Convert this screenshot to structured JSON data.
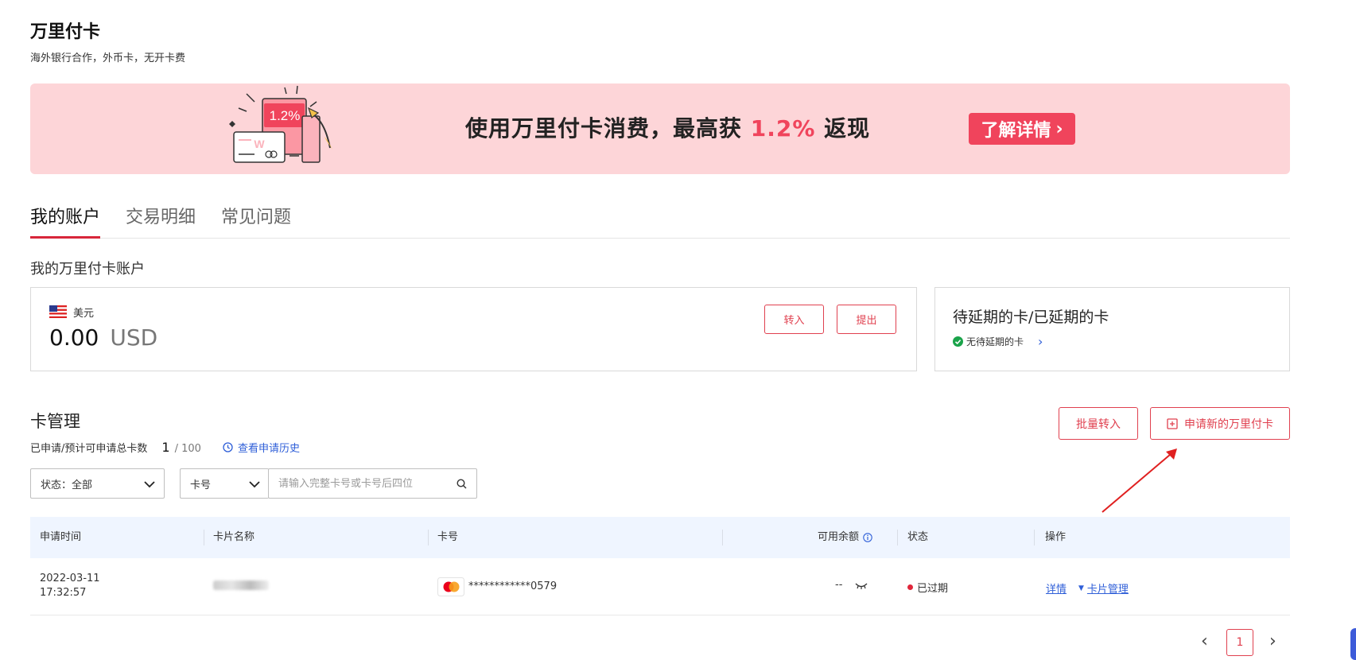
{
  "header": {
    "title": "万里付卡",
    "subtitle": "海外银行合作，外币卡，无开卡费"
  },
  "banner": {
    "text_pre": "使用万里付卡消费，最高获",
    "text_highlight": "1.2%",
    "text_post": "返现",
    "card_badge": "1.2%",
    "card_letter": "W",
    "button_label": "了解详情",
    "button_chevron": "›"
  },
  "tabs": [
    {
      "label": "我的账户",
      "active": true
    },
    {
      "label": "交易明细",
      "active": false
    },
    {
      "label": "常见问题",
      "active": false
    }
  ],
  "account": {
    "section_label": "我的万里付卡账户",
    "currency_name": "美元",
    "balance_value": "0.00",
    "balance_unit": "USD",
    "transfer_in_label": "转入",
    "withdraw_label": "提出"
  },
  "extension": {
    "title": "待延期的卡/已延期的卡",
    "status_text": "无待延期的卡",
    "chevron": "›"
  },
  "card_management": {
    "title": "卡管理",
    "apply_info_label": "已申请/预计可申请总卡数",
    "applied_count": "1",
    "total_count": "/ 100",
    "history_link": "查看申请历史",
    "batch_transfer_label": "批量转入",
    "apply_new_label": "申请新的万里付卡"
  },
  "filters": {
    "status_select": "状态：全部",
    "field_select": "卡号",
    "search_placeholder": "请输入完整卡号或卡号后四位"
  },
  "table": {
    "columns": [
      "申请时间",
      "卡片名称",
      "卡号",
      "可用余额",
      "状态",
      "操作"
    ],
    "rows": [
      {
        "date": "2022-03-11",
        "time": "17:32:57",
        "card_number": "************0579",
        "balance": "--",
        "status": "已过期",
        "action_detail": "详情",
        "action_manage": "卡片管理"
      }
    ]
  },
  "pagination": {
    "current_page": "1"
  },
  "colors": {
    "accent": "#f0445c",
    "link": "#2f5fd8",
    "banner_bg": "#fdd5d8",
    "table_header_bg": "#eff5ff",
    "status_ok": "#1aa34a",
    "status_expired": "#e0263a"
  }
}
